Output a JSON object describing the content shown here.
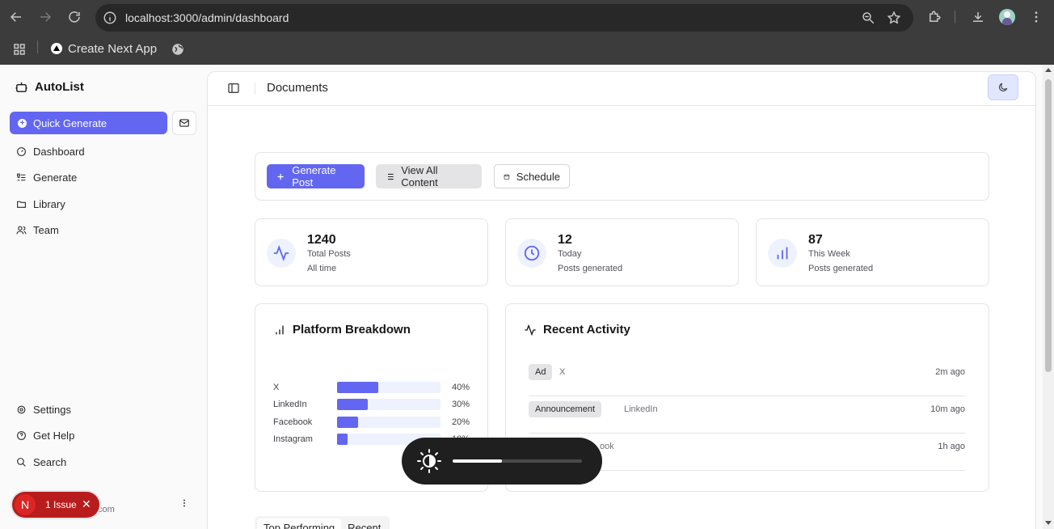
{
  "browser": {
    "url": "localhost:3000/admin/dashboard",
    "bookmark_label": "Create Next App"
  },
  "sidebar": {
    "brand": "AutoList",
    "quick_generate_label": "Quick Generate",
    "nav_items": [
      {
        "label": "Dashboard",
        "icon": "gauge-icon"
      },
      {
        "label": "Generate",
        "icon": "list-icon"
      },
      {
        "label": "Library",
        "icon": "folder-icon"
      },
      {
        "label": "Team",
        "icon": "users-icon"
      }
    ],
    "secondary_items": [
      {
        "label": "Settings",
        "icon": "gear-icon"
      },
      {
        "label": "Get Help",
        "icon": "help-icon"
      },
      {
        "label": "Search",
        "icon": "search-icon"
      }
    ],
    "user_email_tail": ".com"
  },
  "header": {
    "title": "Documents"
  },
  "actions": {
    "generate_post": "Generate Post",
    "view_all_content": "View All Content",
    "schedule": "Schedule"
  },
  "stats": [
    {
      "value": "1240",
      "label": "Total Posts",
      "sub": "All time",
      "icon": "activity-icon"
    },
    {
      "value": "12",
      "label": "Today",
      "sub": "Posts generated",
      "icon": "clock-icon"
    },
    {
      "value": "87",
      "label": "This Week",
      "sub": "Posts generated",
      "icon": "bar-chart-icon"
    }
  ],
  "platform_breakdown": {
    "title": "Platform Breakdown",
    "rows": [
      {
        "name": "X",
        "percent": 40,
        "label": "40%"
      },
      {
        "name": "LinkedIn",
        "percent": 30,
        "label": "30%"
      },
      {
        "name": "Facebook",
        "percent": 20,
        "label": "20%"
      },
      {
        "name": "Instagram",
        "percent": 10,
        "label": "10%"
      }
    ]
  },
  "recent_activity": {
    "title": "Recent Activity",
    "rows": [
      {
        "tag": "Ad",
        "platform": "X",
        "time": "2m ago"
      },
      {
        "tag": "Announcement",
        "platform": "LinkedIn",
        "time": "10m ago"
      },
      {
        "tag": "",
        "platform": "ook",
        "time": "1h ago"
      }
    ]
  },
  "tabs": {
    "top_performing": "Top Performing",
    "recent": "Recent"
  },
  "issue_badge": {
    "letter": "N",
    "text": "1 Issue",
    "close": "✕"
  },
  "osd": {
    "brightness": 0.38
  },
  "colors": {
    "accent": "#6366f1",
    "accent_light": "#eef2ff",
    "error": "#b91c1c"
  }
}
